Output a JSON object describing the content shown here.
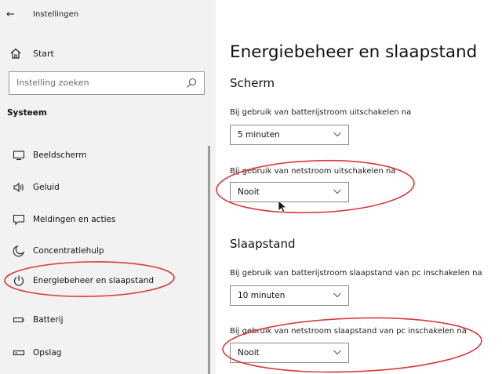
{
  "window": {
    "title": "Instellingen"
  },
  "sidebar": {
    "start_label": "Start",
    "search_placeholder": "Instelling zoeken",
    "category": "Systeem",
    "items": [
      {
        "label": "Beeldscherm",
        "icon": "monitor-icon"
      },
      {
        "label": "Geluid",
        "icon": "speaker-icon"
      },
      {
        "label": "Meldingen en acties",
        "icon": "message-icon"
      },
      {
        "label": "Concentratiehulp",
        "icon": "moon-icon"
      },
      {
        "label": "Energiebeheer en slaapstand",
        "icon": "power-icon",
        "selected": true
      },
      {
        "label": "Batterij",
        "icon": "battery-icon"
      },
      {
        "label": "Opslag",
        "icon": "storage-icon"
      }
    ]
  },
  "main": {
    "title": "Energiebeheer en slaapstand",
    "screen_section": {
      "title": "Scherm",
      "battery_label": "Bij gebruik van batterijstroom uitschakelen na",
      "battery_value": "5 minuten",
      "power_label": "Bij gebruik van netstroom uitschakelen na",
      "power_value": "Nooit"
    },
    "sleep_section": {
      "title": "Slaapstand",
      "battery_label": "Bij gebruik van batterijstroom slaapstand van pc inschakelen na",
      "battery_value": "10 minuten",
      "power_label": "Bij gebruik van netstroom slaapstand van pc inschakelen na",
      "power_value": "Nooit"
    }
  },
  "colors": {
    "annotation": "#d93a3a",
    "sidebar_bg": "#f2f2f2"
  }
}
